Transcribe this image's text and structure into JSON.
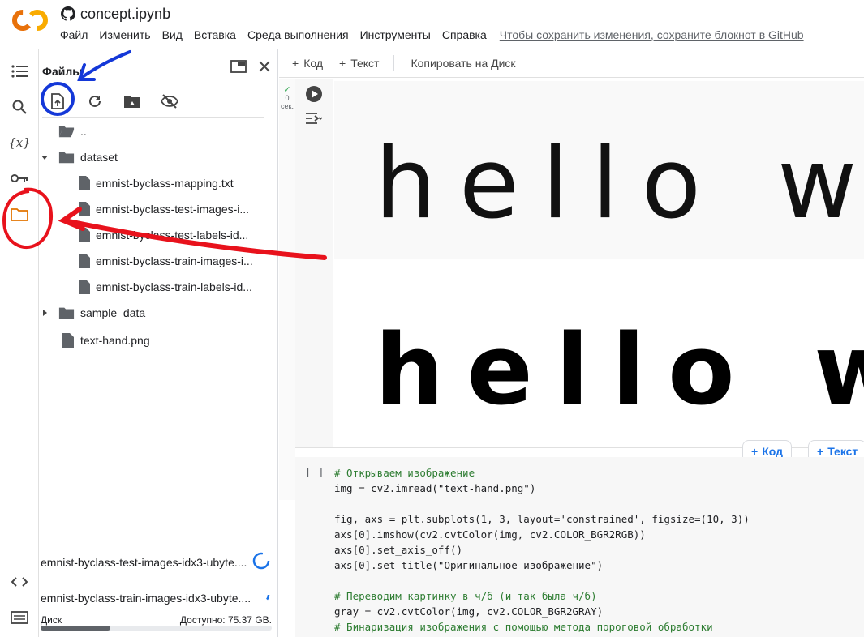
{
  "header": {
    "title": "concept.ipynb",
    "menu": [
      "Файл",
      "Изменить",
      "Вид",
      "Вставка",
      "Среда выполнения",
      "Инструменты",
      "Справка"
    ],
    "save_link": "Чтобы сохранить изменения, сохраните блокнот в GitHub"
  },
  "files_panel": {
    "title": "Файлы",
    "tree": [
      {
        "label": "..",
        "kind": "parent-folder"
      },
      {
        "label": "dataset",
        "kind": "folder-open"
      },
      {
        "label": "emnist-byclass-mapping.txt",
        "kind": "file"
      },
      {
        "label": "emnist-byclass-test-images-i...",
        "kind": "file"
      },
      {
        "label": "emnist-byclass-test-labels-id...",
        "kind": "file"
      },
      {
        "label": "emnist-byclass-train-images-i...",
        "kind": "file"
      },
      {
        "label": "emnist-byclass-train-labels-id...",
        "kind": "file"
      },
      {
        "label": "sample_data",
        "kind": "folder-closed"
      },
      {
        "label": "text-hand.png",
        "kind": "file"
      }
    ],
    "uploads": [
      {
        "name": "emnist-byclass-test-images-idx3-ubyte...."
      },
      {
        "name": "emnist-byclass-train-images-idx3-ubyte...."
      }
    ],
    "disk": {
      "label": "Диск",
      "free": "Доступно: 75.37 GB.",
      "used_fraction": 0.3
    }
  },
  "notebook": {
    "toolbar": {
      "add_code": "Код",
      "add_text": "Текст",
      "copy_to_drive": "Копировать на Диск"
    },
    "exec_status": {
      "line1": "0",
      "line2": "сек."
    },
    "output_text": {
      "line1": "hello wo",
      "line2": "hello wo"
    },
    "add_buttons": {
      "code": "Код",
      "text": "Текст"
    },
    "run_slot": "[ ]",
    "code_lines": [
      {
        "text": "# Открываем изображение",
        "kind": "comment"
      },
      {
        "text": "img = cv2.imread(\"text-hand.png\")",
        "kind": "code"
      },
      {
        "text": "",
        "kind": "code"
      },
      {
        "text": "fig, axs = plt.subplots(1, 3, layout='constrained', figsize=(10, 3))",
        "kind": "code"
      },
      {
        "text": "axs[0].imshow(cv2.cvtColor(img, cv2.COLOR_BGR2RGB))",
        "kind": "code"
      },
      {
        "text": "axs[0].set_axis_off()",
        "kind": "code"
      },
      {
        "text": "axs[0].set_title(\"Оригинальное изображение\")",
        "kind": "code"
      },
      {
        "text": "",
        "kind": "code"
      },
      {
        "text": "# Переводим картинку в ч/б (и так была ч/б)",
        "kind": "comment"
      },
      {
        "text": "gray = cv2.cvtColor(img, cv2.COLOR_BGR2GRAY)",
        "kind": "code"
      },
      {
        "text": "# Бинаризация изображения с помощью метода пороговой обработки",
        "kind": "comment"
      }
    ]
  },
  "colors": {
    "accent": "#1a73e8",
    "annotation_red": "#e8121c",
    "annotation_blue": "#1438d8",
    "logo_orange": "#f9ab00",
    "logo_dark_orange": "#e8710a"
  }
}
